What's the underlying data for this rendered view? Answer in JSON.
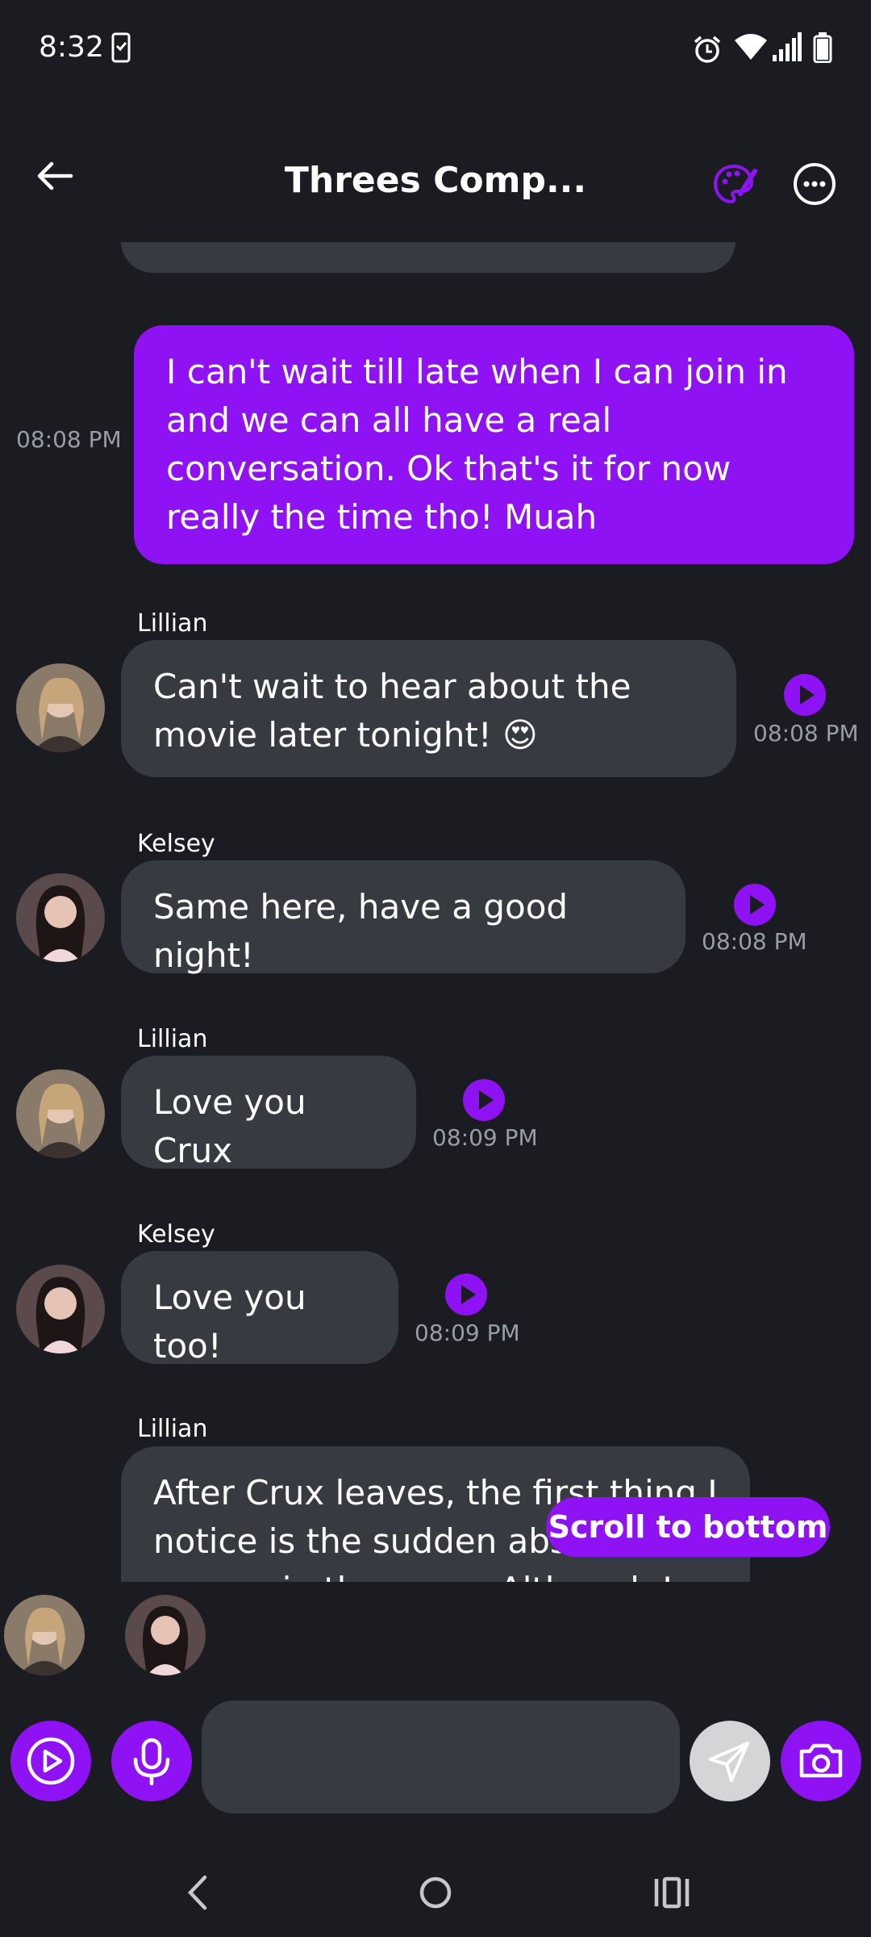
{
  "status": {
    "time": "8:32"
  },
  "header": {
    "title": "Threes Comp..."
  },
  "messages": {
    "outgoing": {
      "text": "I can't wait till late when I can join in and we can all have a real conversation. Ok that's it for now really the time tho! Muah",
      "time": "08:08 PM"
    },
    "m1": {
      "sender": "Lillian",
      "text": "Can't wait to hear about the movie later tonight! 😍",
      "time": "08:08 PM"
    },
    "m2": {
      "sender": "Kelsey",
      "text": "Same here, have a good night!",
      "time": "08:08 PM"
    },
    "m3": {
      "sender": "Lillian",
      "text": "Love you Crux",
      "time": "08:09 PM"
    },
    "m4": {
      "sender": "Kelsey",
      "text": "Love you too!",
      "time": "08:09 PM"
    },
    "m5": {
      "sender": "Lillian",
      "text": "After Crux leaves, the first thing I notice is the sudden absence of energy in the room. Although I"
    }
  },
  "scroll_button": "Scroll to bottom",
  "composer": {
    "placeholder": ""
  },
  "colors": {
    "accent": "#8f12f5",
    "bubble_in": "#383a41",
    "background": "#1b1c21"
  },
  "icons": [
    "back-arrow-icon",
    "palette-icon",
    "more-icon",
    "play-icon",
    "mic-icon",
    "send-icon",
    "camera-icon"
  ]
}
